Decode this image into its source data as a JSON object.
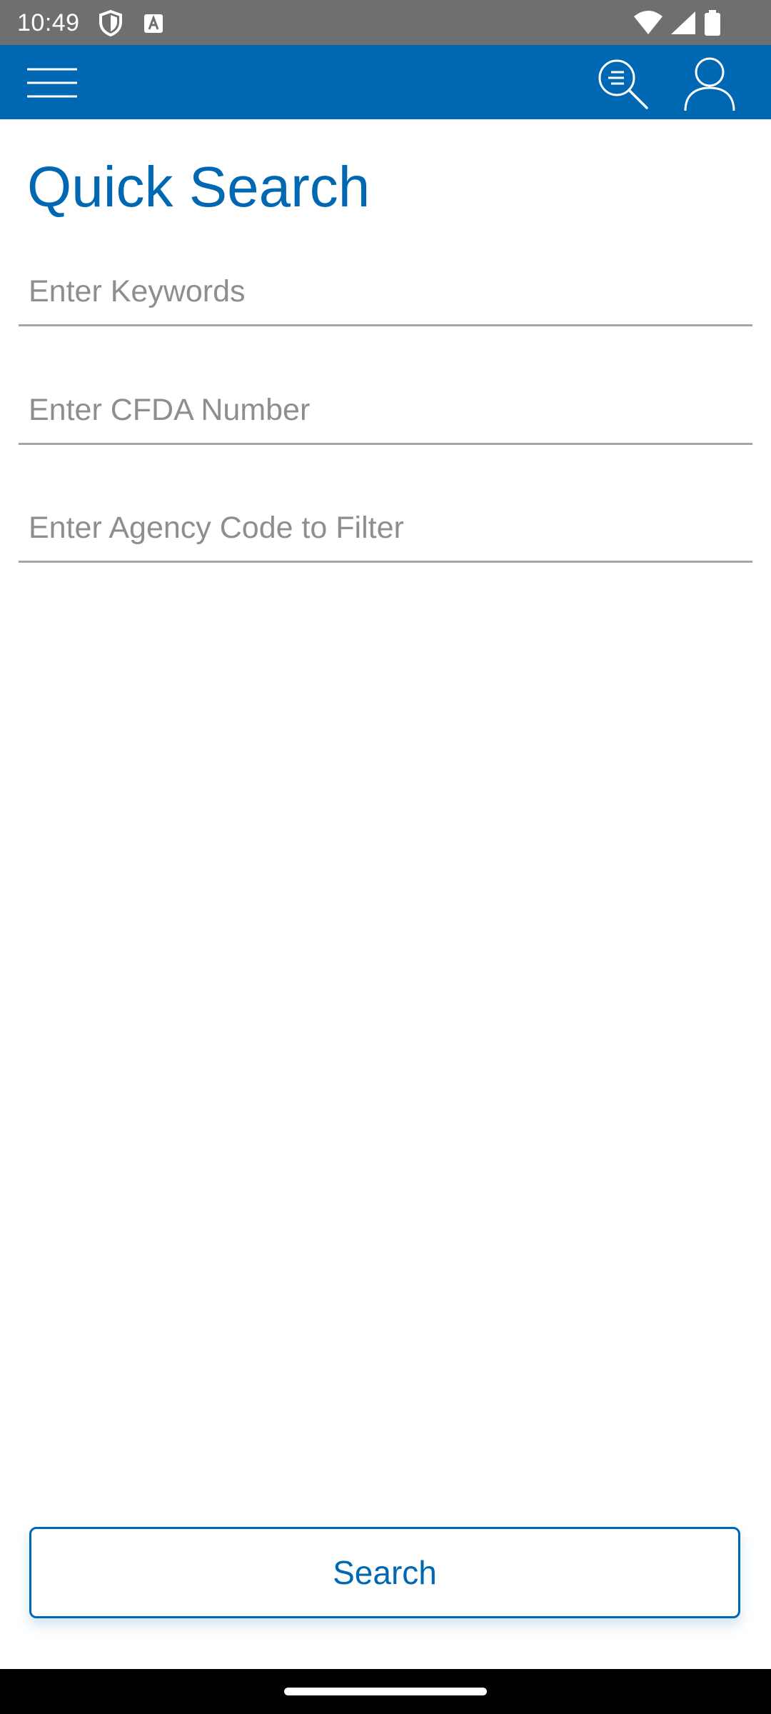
{
  "status_bar": {
    "time": "10:49",
    "icons": [
      "shield-icon",
      "a-letter-icon",
      "wifi-icon",
      "signal-icon",
      "battery-icon"
    ]
  },
  "app_bar": {
    "background": "#0068b3",
    "icons": [
      "menu-icon",
      "search-list-icon",
      "profile-icon"
    ]
  },
  "page": {
    "title": "Quick Search"
  },
  "form": {
    "keywords_placeholder": "Enter Keywords",
    "keywords_value": "",
    "cfda_placeholder": "Enter CFDA Number",
    "cfda_value": "",
    "agency_placeholder": "Enter Agency Code to Filter",
    "agency_value": ""
  },
  "actions": {
    "search_label": "Search"
  },
  "colors": {
    "accent": "#0068b3",
    "status_bar": "#6f6f6f",
    "placeholder": "#8e8e8e",
    "underline": "#a6a6a6"
  }
}
